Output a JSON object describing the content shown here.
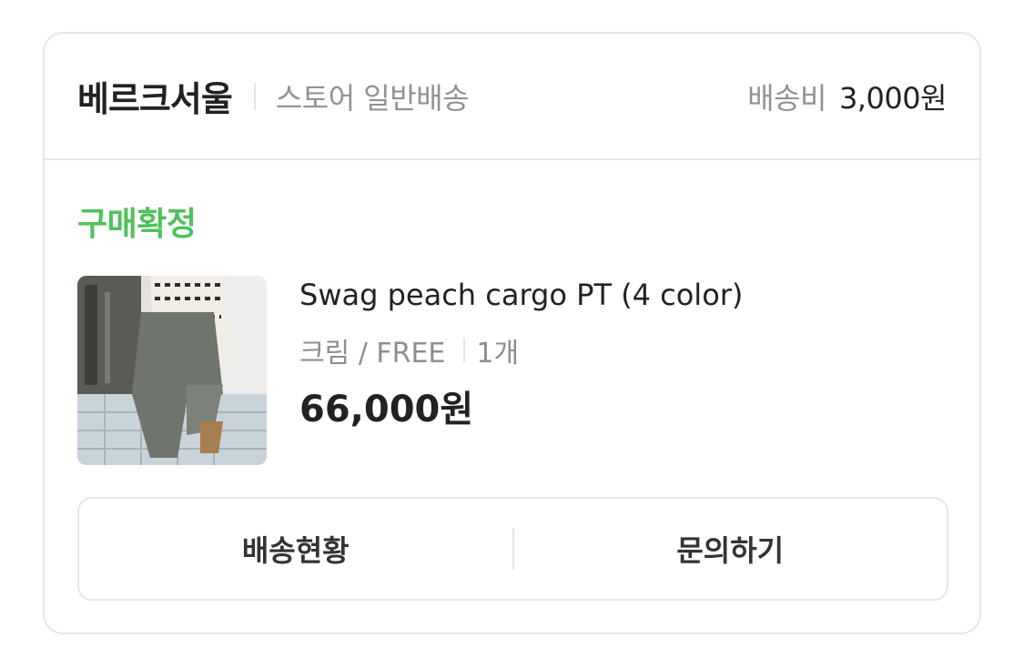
{
  "order": {
    "store_name": "베르크서울",
    "delivery_type": "스토어 일반배송",
    "shipping_fee_label": "배송비",
    "shipping_fee_value": "3,000원",
    "status": "구매확정",
    "status_color": "#4fc15c",
    "product": {
      "name": "Swag peach cargo PT (4 color)",
      "option": "크림 / FREE",
      "quantity": "1개",
      "price": "66,000원"
    },
    "actions": {
      "tracking_label": "배송현황",
      "inquiry_label": "문의하기"
    }
  }
}
